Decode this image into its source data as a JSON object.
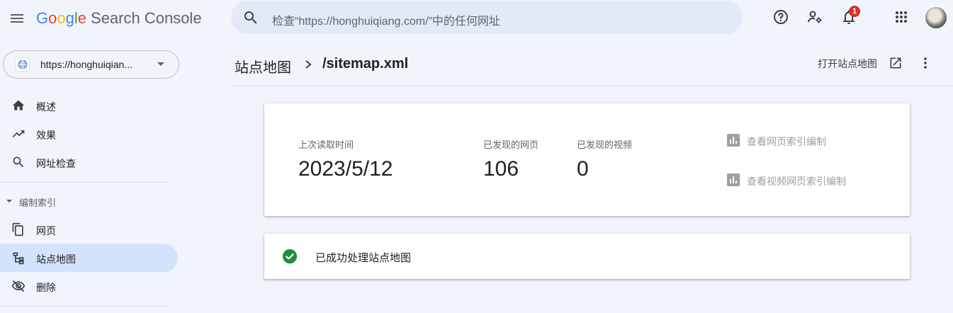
{
  "header": {
    "logo_letters": [
      "G",
      "o",
      "o",
      "g",
      "l",
      "e"
    ],
    "product_name": "Search Console",
    "search_placeholder": "检查“https://honghuiqiang.com/”中的任何网址",
    "notification_count": "1"
  },
  "sidebar": {
    "property": "https://honghuiqian...",
    "items": [
      {
        "label": "概述",
        "icon": "home-icon"
      },
      {
        "label": "效果",
        "icon": "trending-up-icon"
      },
      {
        "label": "网址检查",
        "icon": "search-icon"
      }
    ],
    "section_label": "编制索引",
    "section_items": [
      {
        "label": "网页",
        "icon": "pages-icon"
      },
      {
        "label": "站点地图",
        "icon": "sitemap-icon",
        "active": true
      },
      {
        "label": "删除",
        "icon": "visibility-off-icon"
      }
    ]
  },
  "main": {
    "breadcrumb_parent": "站点地图",
    "breadcrumb_current": "/sitemap.xml",
    "open_sitemap_label": "打开站点地图",
    "stats": {
      "last_read_label": "上次读取时间",
      "last_read_value": "2023/5/12",
      "pages_label": "已发现的网页",
      "pages_value": "106",
      "videos_label": "已发现的视频",
      "videos_value": "0"
    },
    "links": {
      "page_index": "查看网页索引编制",
      "video_index": "查看视频网页索引编制"
    },
    "status_text": "已成功处理站点地图"
  },
  "colors": {
    "accent": "#1a73e8",
    "active_nav_bg": "#d3e3fd",
    "success": "#1e8e3e",
    "badge": "#d93025"
  }
}
